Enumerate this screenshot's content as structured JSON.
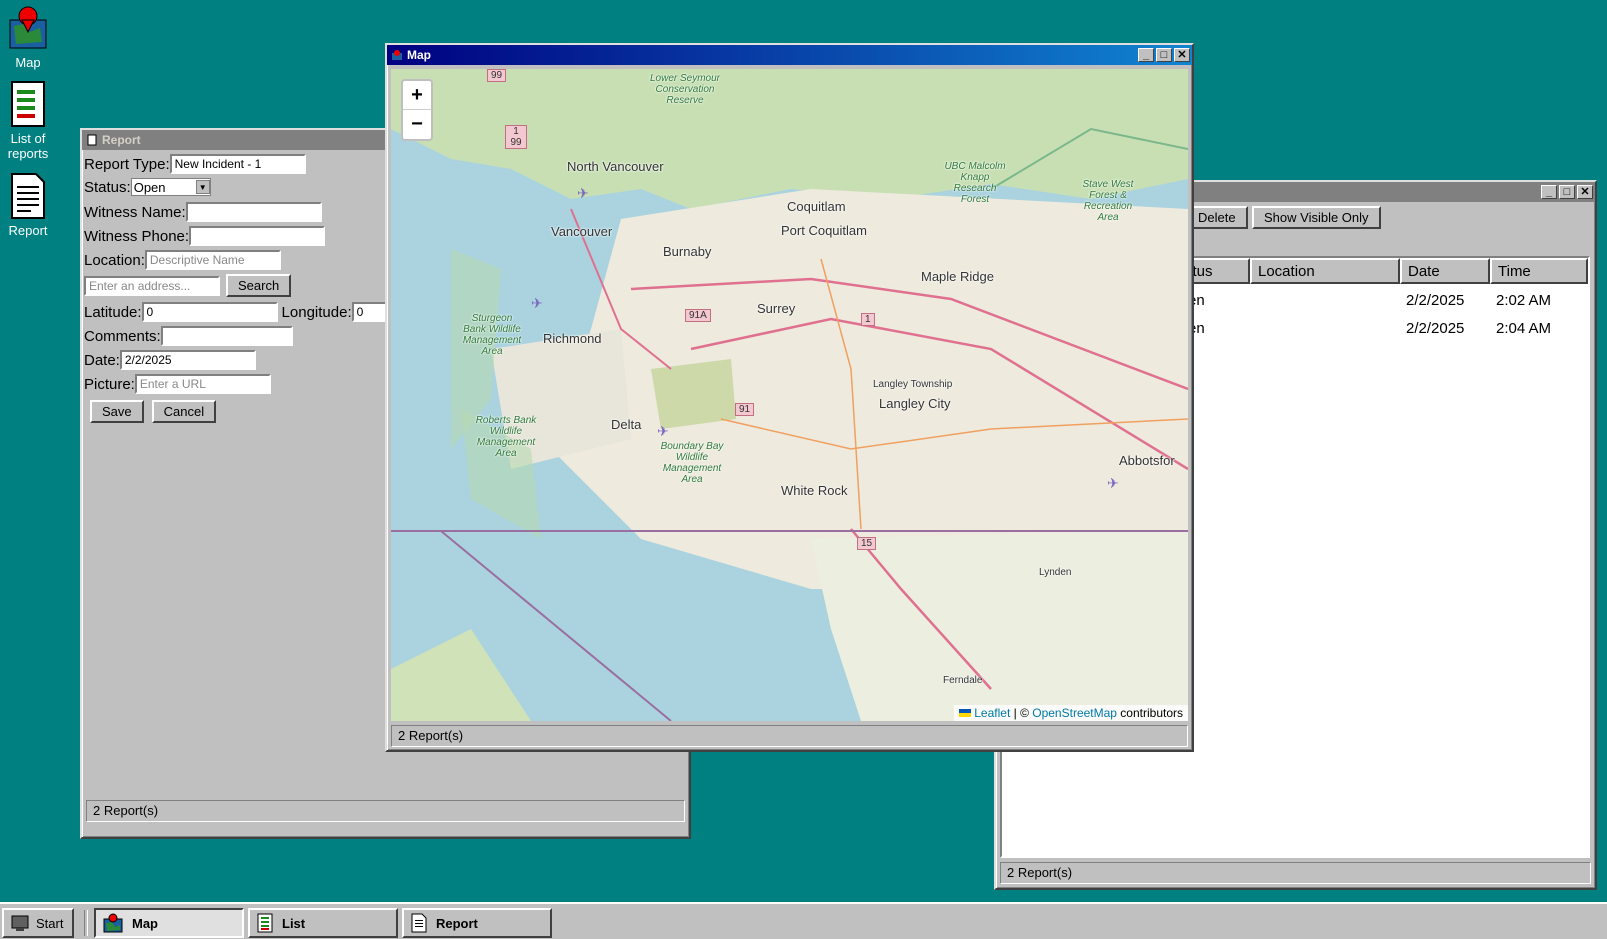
{
  "desktop": {
    "icons": [
      {
        "label": "Map"
      },
      {
        "label": "List of reports"
      },
      {
        "label": "Report"
      }
    ]
  },
  "report_window": {
    "title": "Report",
    "report_type_label": "Report Type:",
    "report_type_value": "New Incident - 1",
    "status_label": "Status:",
    "status_value": "Open",
    "witness_name_label": "Witness Name:",
    "witness_name_value": "",
    "witness_phone_label": "Witness Phone:",
    "witness_phone_value": "",
    "location_label": "Location:",
    "location_placeholder": "Descriptive Name",
    "address_placeholder": "Enter an address...",
    "search_label": "Search",
    "latitude_label": "Latitude:",
    "latitude_value": "0",
    "longitude_label": "Longitude:",
    "longitude_value": "0",
    "comments_label": "Comments:",
    "comments_value": "",
    "date_label": "Date:",
    "date_value": "2/2/2025",
    "picture_label": "Picture:",
    "picture_placeholder": "Enter a URL",
    "save_label": "Save",
    "cancel_label": "Cancel",
    "status_bar": "2 Report(s)"
  },
  "list_window": {
    "delete_label": "Delete",
    "show_visible_label": "Show Visible Only",
    "columns": [
      "Status",
      "Location",
      "Date",
      "Time"
    ],
    "rows": [
      {
        "status": "Open",
        "location": "",
        "date": "2/2/2025",
        "time": "2:02 AM"
      },
      {
        "status": "Open",
        "location": "",
        "date": "2/2/2025",
        "time": "2:04 AM"
      }
    ],
    "status_bar": "2 Report(s)"
  },
  "map_window": {
    "title": "Map",
    "zoom_in": "+",
    "zoom_out": "−",
    "attribution_leaflet": "Leaflet",
    "attribution_sep": " | © ",
    "attribution_osm": "OpenStreetMap",
    "attribution_tail": " contributors",
    "status_bar": "2 Report(s)",
    "places": {
      "north_vancouver": "North Vancouver",
      "vancouver": "Vancouver",
      "burnaby": "Burnaby",
      "coquitlam": "Coquitlam",
      "port_coquitlam": "Port Coquitlam",
      "maple_ridge": "Maple Ridge",
      "richmond": "Richmond",
      "surrey": "Surrey",
      "langley_township": "Langley Township",
      "langley_city": "Langley City",
      "delta": "Delta",
      "white_rock": "White Rock",
      "abbotsford": "Abbotsfor",
      "lynden": "Lynden",
      "ferndale": "Ferndale",
      "lower_seymour": "Lower Seymour Conservation Reserve",
      "ubc_forest": "UBC Malcolm Knapp Research Forest",
      "stave_west": "Stave West Forest & Recreation Area",
      "sturgeon_bank": "Sturgeon Bank Wildlife Management Area",
      "roberts_bank": "Roberts Bank Wildlife Management Area",
      "boundary_bay": "Boundary Bay Wildlife Management Area"
    },
    "shields": [
      "99",
      "1 99",
      "91A",
      "1",
      "91",
      "15"
    ]
  },
  "taskbar": {
    "start_label": "Start",
    "buttons": [
      {
        "label": "Map"
      },
      {
        "label": "List"
      },
      {
        "label": "Report"
      }
    ]
  }
}
